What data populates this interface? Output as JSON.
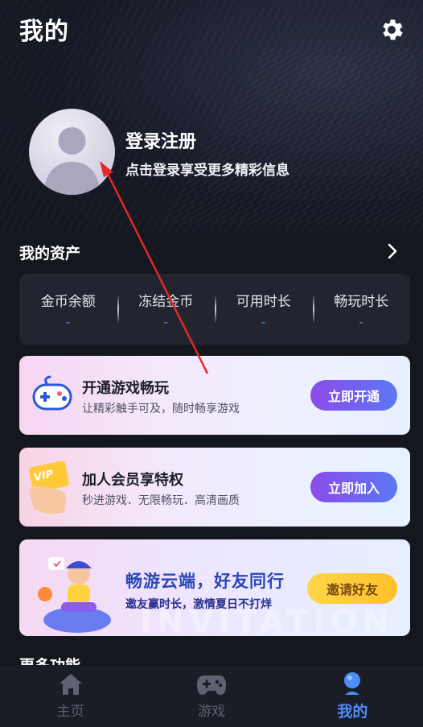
{
  "header": {
    "title": "我的"
  },
  "profile": {
    "login_title": "登录注册",
    "login_subtitle": "点击登录享受更多精彩信息"
  },
  "assets": {
    "title": "我的资产",
    "items": [
      {
        "label": "金币余额",
        "value": "-"
      },
      {
        "label": "冻结金币",
        "value": "-"
      },
      {
        "label": "可用时长",
        "value": "-"
      },
      {
        "label": "畅玩时长",
        "value": "-"
      }
    ]
  },
  "promos": [
    {
      "title": "开通游戏畅玩",
      "subtitle": "让精彩触手可及，随时畅享游戏",
      "button": "立即开通"
    },
    {
      "title": "加人会员享特权",
      "subtitle": "秒进游戏．无限畅玩．高清画质",
      "button": "立即加入",
      "badge": "VIP"
    },
    {
      "title": "畅游云端，好友同行",
      "subtitle": "邀友赢时长，激情夏日不打烊",
      "button": "邀请好友",
      "watermark": "INVITATION"
    }
  ],
  "more": {
    "title": "更多功能"
  },
  "tabbar": {
    "items": [
      {
        "label": "主页"
      },
      {
        "label": "游戏"
      },
      {
        "label": "我的"
      }
    ]
  },
  "colors": {
    "accent": "#4d8df7",
    "background": "#15171f",
    "card": "#22252f",
    "annotation_arrow": "#e3262b"
  }
}
